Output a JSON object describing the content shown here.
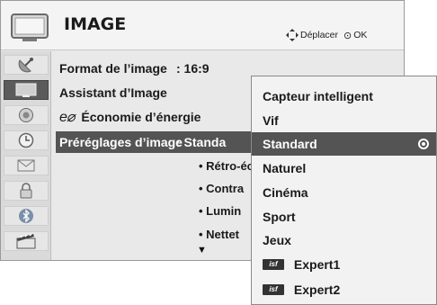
{
  "header": {
    "title": "IMAGE",
    "move_hint": "Déplacer",
    "ok_hint": "OK",
    "tv_icon": "tv-screen-icon",
    "move_icon": "four-way-arrows-icon",
    "ok_icon": "ok-button-icon"
  },
  "sidebar": {
    "items": [
      {
        "icon": "satellite-dish-icon",
        "active": false
      },
      {
        "icon": "picture-icon",
        "active": true
      },
      {
        "icon": "speaker-icon",
        "active": false
      },
      {
        "icon": "clock-icon",
        "active": false
      },
      {
        "icon": "envelope-icon",
        "active": false
      },
      {
        "icon": "lock-icon",
        "active": false
      },
      {
        "icon": "bluetooth-icon",
        "active": false
      },
      {
        "icon": "film-icon",
        "active": false
      }
    ]
  },
  "menu": {
    "format_label": "Format de l’image",
    "format_value": ": 16:9",
    "assistant_label": "Assistant d’Image",
    "eco_mark": "e⌀",
    "eco_label": "Économie d’énergie",
    "presets_label": "Préréglages d’image",
    "presets_value": ": Standa",
    "sub_items": [
      "• Rétro-éc",
      "• Contra",
      "• Lumin",
      "• Nettet"
    ],
    "more_arrow": "▼"
  },
  "dropdown": {
    "items": [
      {
        "label": "Capteur intelligent",
        "isf": false
      },
      {
        "label": "Vif",
        "isf": false
      },
      {
        "label": "Standard",
        "isf": false,
        "selected": true
      },
      {
        "label": "Naturel",
        "isf": false
      },
      {
        "label": "Cinéma",
        "isf": false
      },
      {
        "label": "Sport",
        "isf": false
      },
      {
        "label": "Jeux",
        "isf": false
      },
      {
        "label": "Expert1",
        "isf": true
      },
      {
        "label": "Expert2",
        "isf": true
      }
    ],
    "isf_badge": "isf"
  },
  "colors": {
    "selected_bg": "#545454",
    "panel_bg": "#e9e9e9",
    "dropdown_bg": "#f2f2f2"
  }
}
